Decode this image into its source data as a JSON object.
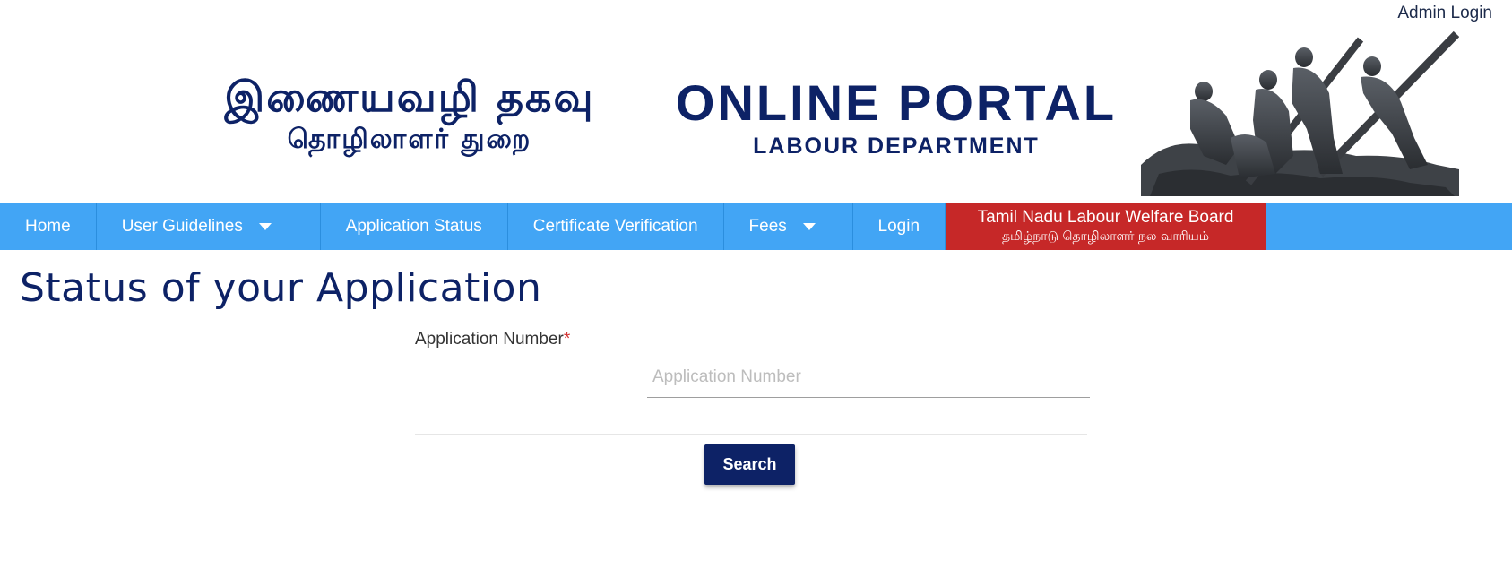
{
  "header": {
    "admin_login": "Admin Login",
    "tamil_line1": "இணையவழி தகவு",
    "tamil_line2": "தொழிலாளர் துறை",
    "portal_title": "ONLINE PORTAL",
    "portal_subtitle": "LABOUR DEPARTMENT",
    "statue_image": "labour-statue-image"
  },
  "nav": {
    "items": [
      {
        "label": "Home"
      },
      {
        "label": "User Guidelines",
        "icon": "caret-down-icon"
      },
      {
        "label": "Application Status"
      },
      {
        "label": "Certificate Verification"
      },
      {
        "label": "Fees",
        "icon": "caret-down-icon"
      },
      {
        "label": "Login"
      }
    ],
    "welfare_board": {
      "line1": "Tamil Nadu Labour Welfare Board",
      "line2": "தமிழ்நாடு தொழிலாளர் நல வாரியம்",
      "color": "#c62828"
    },
    "color": "#42a5f5"
  },
  "main": {
    "title": "Status of your Application",
    "form": {
      "label": "Application Number",
      "required_mark": "*",
      "placeholder": "Application Number",
      "value": "",
      "search_label": "Search"
    }
  },
  "colors": {
    "primary": "#0d2266",
    "nav": "#42a5f5",
    "accent_red": "#c62828"
  }
}
